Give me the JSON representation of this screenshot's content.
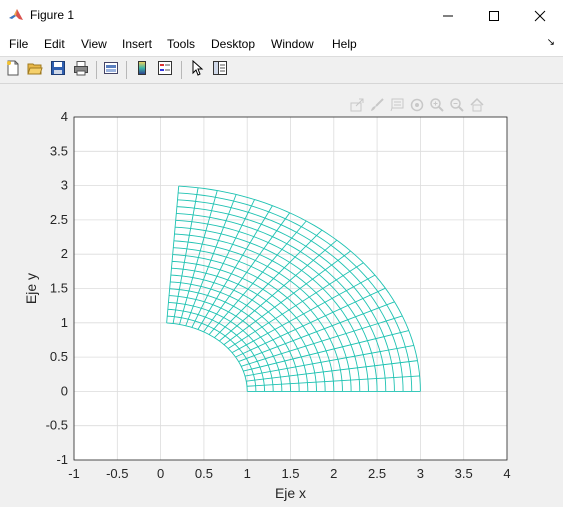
{
  "window": {
    "title": "Figure 1",
    "icon": "matlab-icon",
    "controls": [
      "minimize-icon",
      "maximize-icon",
      "close-icon"
    ]
  },
  "menu": {
    "items": [
      "File",
      "Edit",
      "View",
      "Insert",
      "Tools",
      "Desktop",
      "Window",
      "Help"
    ]
  },
  "toolbar": {
    "icons": [
      "new-figure-icon",
      "open-file-icon",
      "save-icon",
      "print-icon",
      "link-plot-icon",
      "colorbar-icon",
      "legend-icon",
      "pointer-icon",
      "property-inspector-icon"
    ]
  },
  "axes_toolbar": {
    "icons": [
      "export-icon",
      "brush-icon",
      "data-tips-icon",
      "rotate-icon",
      "zoom-in-icon",
      "zoom-out-icon",
      "home-icon"
    ]
  },
  "colors": {
    "mesh": "#1fc2b2",
    "grid": "#dcdcdc",
    "axes_bg": "#ffffff",
    "figure_bg": "#f0f0f0"
  },
  "chart_data": {
    "type": "line",
    "title": "",
    "xlabel": "Eje x",
    "ylabel": "Eje y",
    "xlim": [
      -1,
      4
    ],
    "ylim": [
      -1,
      4
    ],
    "xticks": [
      "-1",
      "-0.5",
      "0",
      "0.5",
      "1",
      "1.5",
      "2",
      "2.5",
      "3",
      "3.5",
      "4"
    ],
    "yticks": [
      "-1",
      "-0.5",
      "0",
      "0.5",
      "1",
      "1.5",
      "2",
      "2.5",
      "3",
      "3.5",
      "4"
    ],
    "grid": true,
    "mesh": {
      "description_type": "polar annular sector grid",
      "r_inner": 1,
      "r_outer": 3,
      "theta_start_deg": 0,
      "theta_end_deg": 86,
      "radial_divisions": 20,
      "angular_divisions": 20
    }
  }
}
